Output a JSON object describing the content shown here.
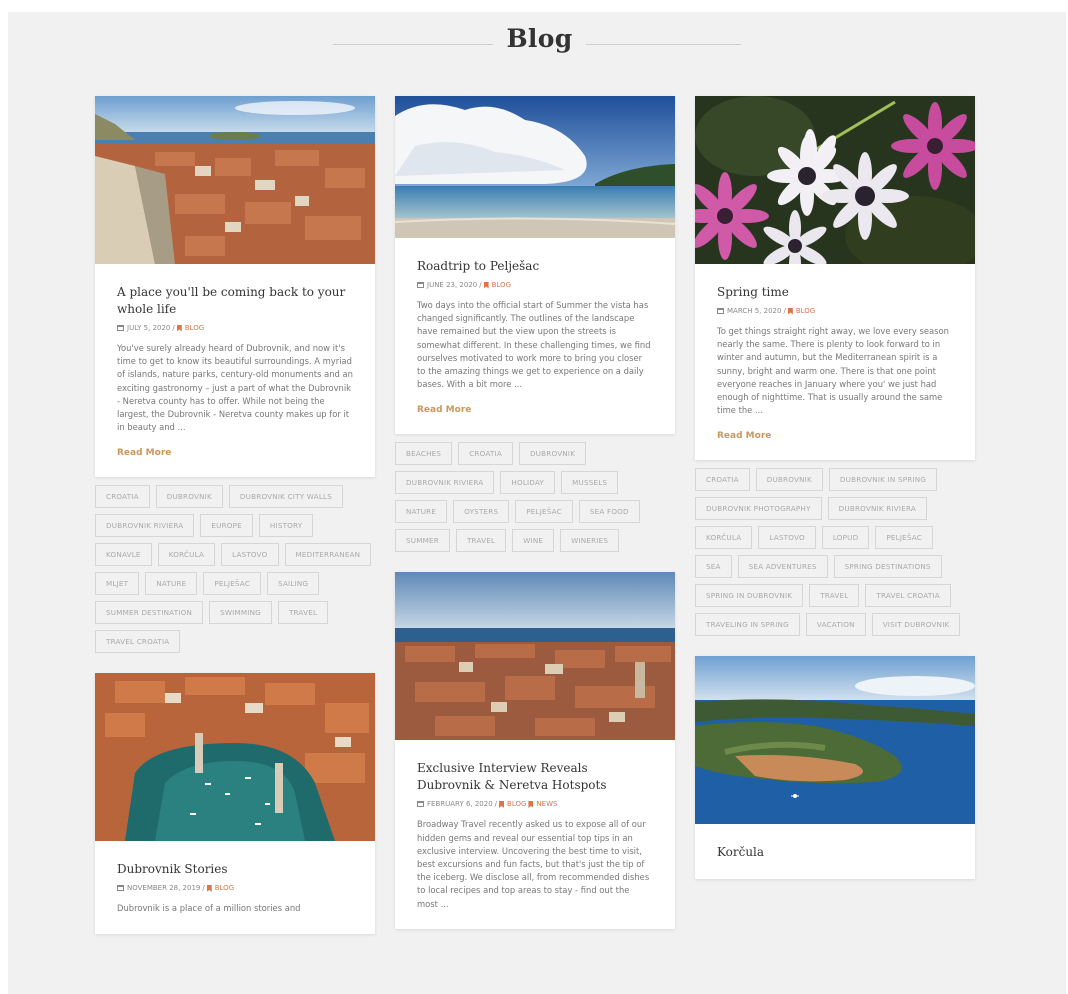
{
  "page": {
    "title": "Blog"
  },
  "posts": {
    "p1": {
      "title": "A place you'll be coming back to your whole life",
      "date": "JULY 5, 2020",
      "sep": "/",
      "categories": [
        "BLOG"
      ],
      "excerpt": "You've surely already heard of Dubrovnik, and now it's time to get to know its beautiful surroundings.  A myriad of islands, nature parks, century-old monuments and an exciting gastronomy – just a part of what the Dubrovnik - Neretva county  has to offer. While not being the largest, the Dubrovnik - Neretva county makes up for it in beauty and ...",
      "read_more": "Read More",
      "tags": [
        "CROATIA",
        "DUBROVNIK",
        "DUBROVNIK CITY WALLS",
        "DUBROVNIK RIVIERA",
        "EUROPE",
        "HISTORY",
        "KONAVLE",
        "KORČULA",
        "LASTOVO",
        "MEDITERRANEAN",
        "MLJET",
        "NATURE",
        "PELJEŠAC",
        "SAILING",
        "SUMMER DESTINATION",
        "SWIMMING",
        "TRAVEL",
        "TRAVEL CROATIA"
      ]
    },
    "p2": {
      "title": "Roadtrip to Pelješac",
      "date": "JUNE 23, 2020",
      "sep": "/",
      "categories": [
        "BLOG"
      ],
      "excerpt": "Two days into the official start of Summer the vista has changed significantly. The outlines of the landscape have remained but the view upon the streets is somewhat different. In these challenging times, we find ourselves motivated to work more to bring you closer to the amazing things we get to experience on a daily bases. With a bit more ...",
      "read_more": "Read More",
      "tags": [
        "BEACHES",
        "CROATIA",
        "DUBROVNIK",
        "DUBROVNIK RIVIERA",
        "HOLIDAY",
        "MUSSELS",
        "NATURE",
        "OYSTERS",
        "PELJEŠAC",
        "SEA FOOD",
        "SUMMER",
        "TRAVEL",
        "WINE",
        "WINERIES"
      ]
    },
    "p3": {
      "title": "Spring time",
      "date": "MARCH 5, 2020",
      "sep": "/",
      "categories": [
        "BLOG"
      ],
      "excerpt": "To get things straight right away, we love every season nearly the same. There is plenty to look forward to in winter and autumn, but the Mediterranean spirit is a sunny, bright and warm one. There is that one point everyone reaches in January where you' we just had enough of nighttime. That is usually around the same time the ...",
      "read_more": "Read More",
      "tags": [
        "CROATIA",
        "DUBROVNIK",
        "DUBROVNIK IN SPRING",
        "DUBROVNIK PHOTOGRAPHY",
        "DUBROVNIK RIVIERA",
        "KORČULA",
        "LASTOVO",
        "LOPUD",
        "PELJEŠAC",
        "SEA",
        "SEA ADVENTURES",
        "SPRING DESTINATIONS",
        "SPRING IN DUBROVNIK",
        "TRAVEL",
        "TRAVEL CROATIA",
        "TRAVELING IN SPRING",
        "VACATION",
        "VISIT DUBROVNIK"
      ]
    },
    "p4": {
      "title": "Dubrovnik Stories",
      "date": "NOVEMBER 28, 2019",
      "sep": "/",
      "categories": [
        "BLOG"
      ],
      "excerpt": "Dubrovnik is a place of a million stories and"
    },
    "p5": {
      "title": "Exclusive Interview Reveals Dubrovnik & Neretva Hotspots",
      "date": "FEBRUARY 6, 2020",
      "sep": "/",
      "categories": [
        "BLOG",
        "NEWS"
      ],
      "excerpt": "Broadway Travel recently asked us to expose all of our hidden gems and reveal our essential top tips in an exclusive interview. Uncovering the best time to visit, best excursions and fun facts, but that's just the tip of the iceberg. We disclose all, from recommended dishes to local recipes and top areas to stay - find out the most ..."
    },
    "p6": {
      "title": "Korčula"
    }
  },
  "colors": {
    "accent": "#c9985c",
    "category": "#d9774a",
    "background": "#f1f1f1"
  },
  "icons": {
    "date": "calendar-icon",
    "category": "bookmark-icon"
  }
}
